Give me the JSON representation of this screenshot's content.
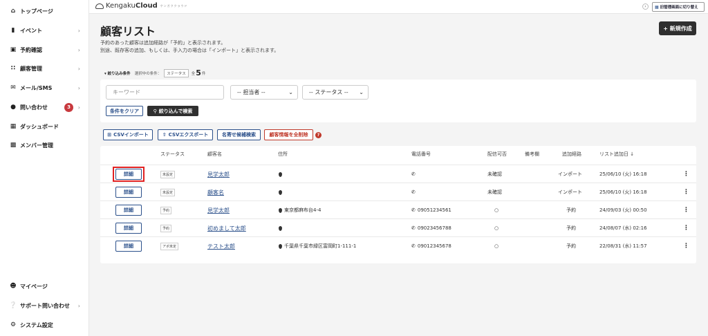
{
  "sidebar": {
    "items": [
      {
        "label": "トップページ",
        "icon": "home-icon",
        "chevron": ""
      },
      {
        "label": "イベント",
        "icon": "document-icon",
        "chevron": "›"
      },
      {
        "label": "予約確認",
        "icon": "calendar-icon",
        "chevron": "›"
      },
      {
        "label": "顧客管理",
        "icon": "users-icon",
        "chevron": "›"
      },
      {
        "label": "メール/SMS",
        "icon": "mail-icon",
        "chevron": "›"
      },
      {
        "label": "問い合わせ",
        "icon": "chat-icon",
        "chevron": "›",
        "badge": "3"
      },
      {
        "label": "ダッシュボード",
        "icon": "chart-icon",
        "chevron": ""
      },
      {
        "label": "メンバー管理",
        "icon": "grid-icon",
        "chevron": ""
      }
    ],
    "bottom": [
      {
        "label": "マイページ",
        "icon": "user-icon",
        "chevron": ""
      },
      {
        "label": "サポート問い合わせ",
        "icon": "help-icon",
        "chevron": "›"
      },
      {
        "label": "システム設定",
        "icon": "gear-icon",
        "chevron": ""
      }
    ]
  },
  "header": {
    "logo_prefix": "Kengaku",
    "logo_bold": "Cloud",
    "logo_sub": "ケンガククラウド",
    "switch_label": "旧管理画面に切り替え"
  },
  "page": {
    "title": "顧客リスト",
    "desc_line1": "予約のあった顧客は追加経路が「予約」と表示されます。",
    "desc_line2": "別途、既存客の追加、もしくは、手入力の場合は「インポート」と表示されます。",
    "new_button": "+ 新規作成"
  },
  "filter": {
    "toggle_label": "▾ 絞り込み条件",
    "selected_label": "選択中の条件：",
    "selected_chip": "ステータス",
    "total_prefix": "全",
    "total_count": "5",
    "total_suffix": "件",
    "keyword_placeholder": "キーワード",
    "staff_select": "-- 担当者 --",
    "status_select": "-- ステータス --",
    "clear_button": "条件をクリア",
    "search_button": "絞り込んで検索"
  },
  "actions": {
    "csv_import": "CSVインポート",
    "csv_export": "CSVエクスポート",
    "duplicate_search": "名寄せ候補検索",
    "delete_all": "顧客情報を全削除"
  },
  "table": {
    "headers": {
      "status": "ステータス",
      "name": "顧客名",
      "address": "住所",
      "phone": "電話番号",
      "deliverable": "配信可否",
      "note": "備考欄",
      "route": "追加経路",
      "date": "リスト追加日 ↓"
    },
    "detail_label": "詳細",
    "rows": [
      {
        "status": "未設定",
        "name": "見学太郎",
        "address": "",
        "phone": "",
        "deliverable": "未確認",
        "route": "インポート",
        "date": "25/06/10 (火) 16:18"
      },
      {
        "status": "未設定",
        "name": "顧客名",
        "address": "",
        "phone": "",
        "deliverable": "未確認",
        "route": "インポート",
        "date": "25/06/10 (火) 16:18"
      },
      {
        "status": "予約",
        "name": "見学太郎",
        "address": "東京都麻布台4-4",
        "phone": "09051234561",
        "deliverable": "○",
        "route": "予約",
        "date": "24/09/03 (火) 00:50"
      },
      {
        "status": "予約",
        "name": "初めまして太郎",
        "address": "",
        "phone": "09023456788",
        "deliverable": "○",
        "route": "予約",
        "date": "24/08/07 (水) 02:16"
      },
      {
        "status": "アポ未定",
        "name": "テスト太郎",
        "address": "千葉県千葉市緑区富岡町1-111-1",
        "phone": "09012345678",
        "deliverable": "○",
        "route": "予約",
        "date": "22/08/31 (水) 11:57"
      }
    ]
  }
}
